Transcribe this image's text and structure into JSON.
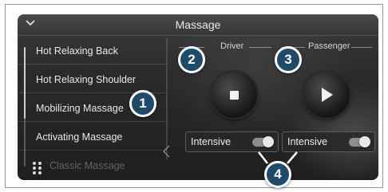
{
  "header": {
    "title": "Massage"
  },
  "massage_list": {
    "items": [
      {
        "label": "Hot Relaxing Back"
      },
      {
        "label": "Hot Relaxing Shoulder"
      },
      {
        "label": "Mobilizing Massage"
      },
      {
        "label": "Activating Massage"
      },
      {
        "label": "Classic Massage"
      }
    ]
  },
  "driver": {
    "label": "Driver",
    "control_icon": "stop-icon",
    "intensive_label": "Intensive",
    "intensive_on": true
  },
  "passenger": {
    "label": "Passenger",
    "control_icon": "play-icon",
    "intensive_label": "Intensive",
    "intensive_on": true
  },
  "callouts": [
    "1",
    "2",
    "3",
    "4"
  ],
  "colors": {
    "callout_fill": "#1f4a6a",
    "callout_border": "#ffffff",
    "panel_bg": "#2b2b2b",
    "frame_border": "#8b98a6"
  }
}
